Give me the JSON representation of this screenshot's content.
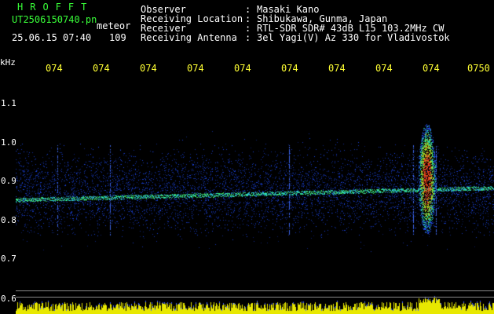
{
  "header": {
    "brand": "HROFFT",
    "filename": "UT2506150740.pn",
    "mode": "meteor",
    "datetime": "25.06.15 07:40",
    "count": "109"
  },
  "info": [
    {
      "label": "Observer",
      "value": "Masaki Kano"
    },
    {
      "label": "Receiving Location",
      "value": "Shibukawa, Gunma, Japan"
    },
    {
      "label": "Receiver",
      "value": "RTL-SDR SDR# 43dB L15 103.2MHz CW"
    },
    {
      "label": "Receiving Antenna",
      "value": "3el Yagi(V) Az 330 for Vladivostok"
    }
  ],
  "axes": {
    "y_unit": "kHz",
    "x_ticks": [
      "074",
      "074",
      "074",
      "074",
      "074",
      "074",
      "074",
      "074",
      "074",
      "0750"
    ],
    "y_ticks": [
      "1.1",
      "1.0",
      "0.9",
      "0.8",
      "0.7",
      "0.6"
    ]
  },
  "colors": {
    "text_green": "#39ff39",
    "text_white": "#ffffff",
    "tick_yellow": "#ffff33",
    "background": "#000000",
    "noise_blue": "#1030c0",
    "signal_green": "#30ff60",
    "meteor_red": "#ff3020"
  }
}
